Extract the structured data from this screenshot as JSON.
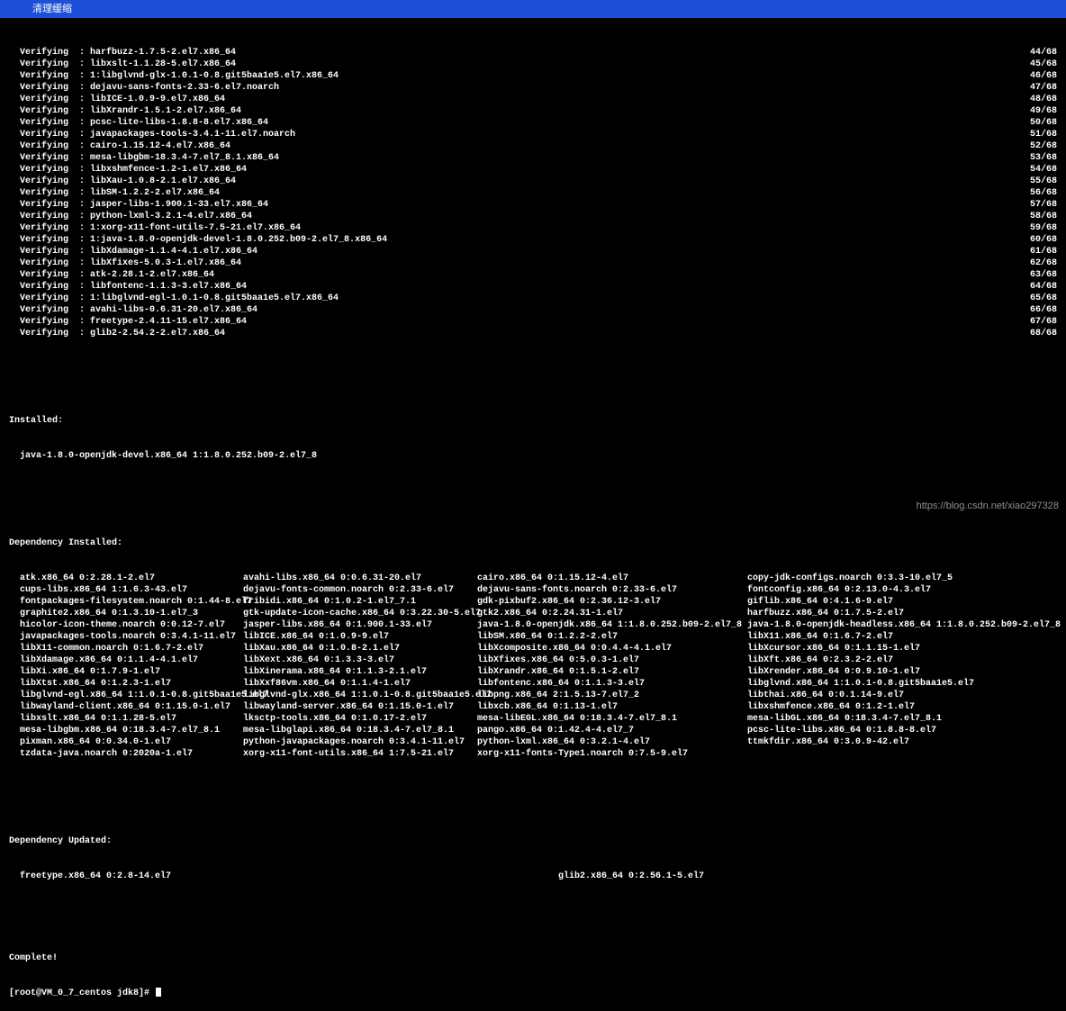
{
  "topbar": {
    "clear_label": "清理缓缩"
  },
  "verify_prefix": "  Verifying  : ",
  "verifying": [
    {
      "pkg": "harfbuzz-1.7.5-2.el7.x86_64",
      "idx": "44/68"
    },
    {
      "pkg": "libxslt-1.1.28-5.el7.x86_64",
      "idx": "45/68"
    },
    {
      "pkg": "1:libglvnd-glx-1.0.1-0.8.git5baa1e5.el7.x86_64",
      "idx": "46/68"
    },
    {
      "pkg": "dejavu-sans-fonts-2.33-6.el7.noarch",
      "idx": "47/68"
    },
    {
      "pkg": "libICE-1.0.9-9.el7.x86_64",
      "idx": "48/68"
    },
    {
      "pkg": "libXrandr-1.5.1-2.el7.x86_64",
      "idx": "49/68"
    },
    {
      "pkg": "pcsc-lite-libs-1.8.8-8.el7.x86_64",
      "idx": "50/68"
    },
    {
      "pkg": "javapackages-tools-3.4.1-11.el7.noarch",
      "idx": "51/68"
    },
    {
      "pkg": "cairo-1.15.12-4.el7.x86_64",
      "idx": "52/68"
    },
    {
      "pkg": "mesa-libgbm-18.3.4-7.el7_8.1.x86_64",
      "idx": "53/68"
    },
    {
      "pkg": "libxshmfence-1.2-1.el7.x86_64",
      "idx": "54/68"
    },
    {
      "pkg": "libXau-1.0.8-2.1.el7.x86_64",
      "idx": "55/68"
    },
    {
      "pkg": "libSM-1.2.2-2.el7.x86_64",
      "idx": "56/68"
    },
    {
      "pkg": "jasper-libs-1.900.1-33.el7.x86_64",
      "idx": "57/68"
    },
    {
      "pkg": "python-lxml-3.2.1-4.el7.x86_64",
      "idx": "58/68"
    },
    {
      "pkg": "1:xorg-x11-font-utils-7.5-21.el7.x86_64",
      "idx": "59/68"
    },
    {
      "pkg": "1:java-1.8.0-openjdk-devel-1.8.0.252.b09-2.el7_8.x86_64",
      "idx": "60/68"
    },
    {
      "pkg": "libXdamage-1.1.4-4.1.el7.x86_64",
      "idx": "61/68"
    },
    {
      "pkg": "libXfixes-5.0.3-1.el7.x86_64",
      "idx": "62/68"
    },
    {
      "pkg": "atk-2.28.1-2.el7.x86_64",
      "idx": "63/68"
    },
    {
      "pkg": "libfontenc-1.1.3-3.el7.x86_64",
      "idx": "64/68"
    },
    {
      "pkg": "1:libglvnd-egl-1.0.1-0.8.git5baa1e5.el7.x86_64",
      "idx": "65/68"
    },
    {
      "pkg": "avahi-libs-0.6.31-20.el7.x86_64",
      "idx": "66/68"
    },
    {
      "pkg": "freetype-2.4.11-15.el7.x86_64",
      "idx": "67/68"
    },
    {
      "pkg": "glib2-2.54.2-2.el7.x86_64",
      "idx": "68/68"
    }
  ],
  "installed_title": "Installed:",
  "installed_pkg": "  java-1.8.0-openjdk-devel.x86_64 1:1.8.0.252.b09-2.el7_8",
  "dep_installed_title": "Dependency Installed:",
  "dep_rows": [
    [
      "  atk.x86_64 0:2.28.1-2.el7",
      "avahi-libs.x86_64 0:0.6.31-20.el7",
      "cairo.x86_64 0:1.15.12-4.el7",
      "copy-jdk-configs.noarch 0:3.3-10.el7_5"
    ],
    [
      "  cups-libs.x86_64 1:1.6.3-43.el7",
      "dejavu-fonts-common.noarch 0:2.33-6.el7",
      "dejavu-sans-fonts.noarch 0:2.33-6.el7",
      "fontconfig.x86_64 0:2.13.0-4.3.el7"
    ],
    [
      "  fontpackages-filesystem.noarch 0:1.44-8.el7",
      "fribidi.x86_64 0:1.0.2-1.el7_7.1",
      "gdk-pixbuf2.x86_64 0:2.36.12-3.el7",
      "giflib.x86_64 0:4.1.6-9.el7"
    ],
    [
      "  graphite2.x86_64 0:1.3.10-1.el7_3",
      "gtk-update-icon-cache.x86_64 0:3.22.30-5.el7",
      "gtk2.x86_64 0:2.24.31-1.el7",
      "harfbuzz.x86_64 0:1.7.5-2.el7"
    ],
    [
      "  hicolor-icon-theme.noarch 0:0.12-7.el7",
      "jasper-libs.x86_64 0:1.900.1-33.el7",
      "java-1.8.0-openjdk.x86_64 1:1.8.0.252.b09-2.el7_8",
      "java-1.8.0-openjdk-headless.x86_64 1:1.8.0.252.b09-2.el7_8"
    ],
    [
      "  javapackages-tools.noarch 0:3.4.1-11.el7",
      "libICE.x86_64 0:1.0.9-9.el7",
      "libSM.x86_64 0:1.2.2-2.el7",
      "libX11.x86_64 0:1.6.7-2.el7"
    ],
    [
      "  libX11-common.noarch 0:1.6.7-2.el7",
      "libXau.x86_64 0:1.0.8-2.1.el7",
      "libXcomposite.x86_64 0:0.4.4-4.1.el7",
      "libXcursor.x86_64 0:1.1.15-1.el7"
    ],
    [
      "  libXdamage.x86_64 0:1.1.4-4.1.el7",
      "libXext.x86_64 0:1.3.3-3.el7",
      "libXfixes.x86_64 0:5.0.3-1.el7",
      "libXft.x86_64 0:2.3.2-2.el7"
    ],
    [
      "  libXi.x86_64 0:1.7.9-1.el7",
      "libXinerama.x86_64 0:1.1.3-2.1.el7",
      "libXrandr.x86_64 0:1.5.1-2.el7",
      "libXrender.x86_64 0:0.9.10-1.el7"
    ],
    [
      "  libXtst.x86_64 0:1.2.3-1.el7",
      "libXxf86vm.x86_64 0:1.1.4-1.el7",
      "libfontenc.x86_64 0:1.1.3-3.el7",
      "libglvnd.x86_64 1:1.0.1-0.8.git5baa1e5.el7"
    ],
    [
      "  libglvnd-egl.x86_64 1:1.0.1-0.8.git5baa1e5.el7",
      "libglvnd-glx.x86_64 1:1.0.1-0.8.git5baa1e5.el7",
      "libpng.x86_64 2:1.5.13-7.el7_2",
      "libthai.x86_64 0:0.1.14-9.el7"
    ],
    [
      "  libwayland-client.x86_64 0:1.15.0-1.el7",
      "libwayland-server.x86_64 0:1.15.0-1.el7",
      "libxcb.x86_64 0:1.13-1.el7",
      "libxshmfence.x86_64 0:1.2-1.el7"
    ],
    [
      "  libxslt.x86_64 0:1.1.28-5.el7",
      "lksctp-tools.x86_64 0:1.0.17-2.el7",
      "mesa-libEGL.x86_64 0:18.3.4-7.el7_8.1",
      "mesa-libGL.x86_64 0:18.3.4-7.el7_8.1"
    ],
    [
      "  mesa-libgbm.x86_64 0:18.3.4-7.el7_8.1",
      "mesa-libglapi.x86_64 0:18.3.4-7.el7_8.1",
      "pango.x86_64 0:1.42.4-4.el7_7",
      "pcsc-lite-libs.x86_64 0:1.8.8-8.el7"
    ],
    [
      "  pixman.x86_64 0:0.34.0-1.el7",
      "python-javapackages.noarch 0:3.4.1-11.el7",
      "python-lxml.x86_64 0:3.2.1-4.el7",
      "ttmkfdir.x86_64 0:3.0.9-42.el7"
    ],
    [
      "  tzdata-java.noarch 0:2020a-1.el7",
      "xorg-x11-font-utils.x86_64 1:7.5-21.el7",
      "xorg-x11-fonts-Type1.noarch 0:7.5-9.el7",
      ""
    ]
  ],
  "dep_updated_title": "Dependency Updated:",
  "dep_updated": [
    "  freetype.x86_64 0:2.8-14.el7",
    "glib2.x86_64 0:2.56.1-5.el7"
  ],
  "complete_label": "Complete!",
  "prompt": "[root@VM_0_7_centos jdk8]# ",
  "watermark": "https://blog.csdn.net/xiao297328"
}
